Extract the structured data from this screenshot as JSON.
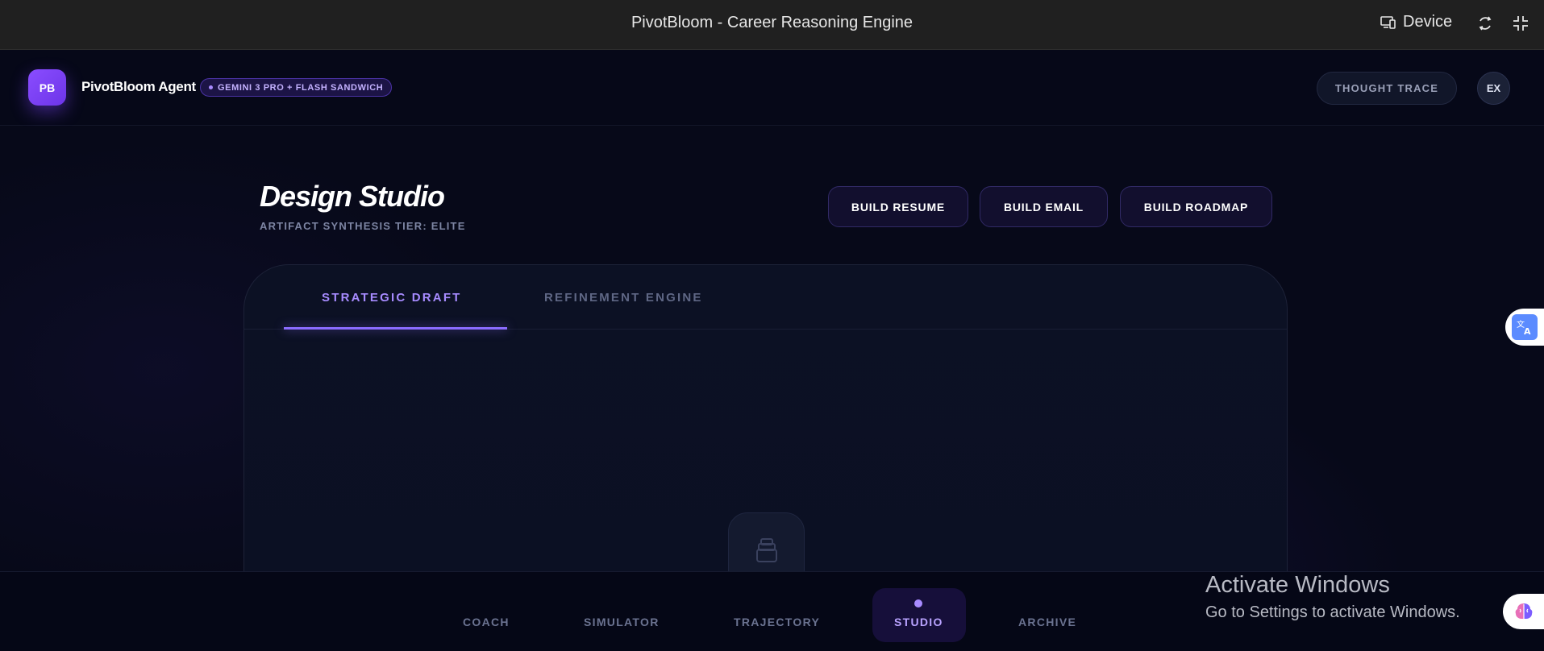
{
  "window": {
    "title": "PivotBloom - Career Reasoning Engine",
    "device_label": "Device"
  },
  "header": {
    "logo_initials": "PB",
    "brand": "PivotBloom Agent",
    "model_badge": "GEMINI 3 PRO + FLASH SANDWICH",
    "thought_trace_label": "THOUGHT TRACE",
    "avatar_initials": "EX"
  },
  "studio": {
    "title": "Design Studio",
    "subtitle": "ARTIFACT SYNTHESIS TIER: ELITE",
    "buttons": [
      "BUILD RESUME",
      "BUILD EMAIL",
      "BUILD ROADMAP"
    ]
  },
  "panel": {
    "tabs": [
      {
        "label": "STRATEGIC DRAFT",
        "active": true
      },
      {
        "label": "REFINEMENT ENGINE",
        "active": false
      }
    ]
  },
  "bottom_nav": {
    "items": [
      "COACH",
      "SIMULATOR",
      "TRAJECTORY",
      "STUDIO",
      "ARCHIVE"
    ],
    "active": "STUDIO"
  },
  "overlay": {
    "activate_title": "Activate Windows",
    "activate_sub": "Go to Settings to activate Windows."
  },
  "colors": {
    "accent": "#8b6cff",
    "background": "#060817",
    "logo": "#7c42ff"
  }
}
